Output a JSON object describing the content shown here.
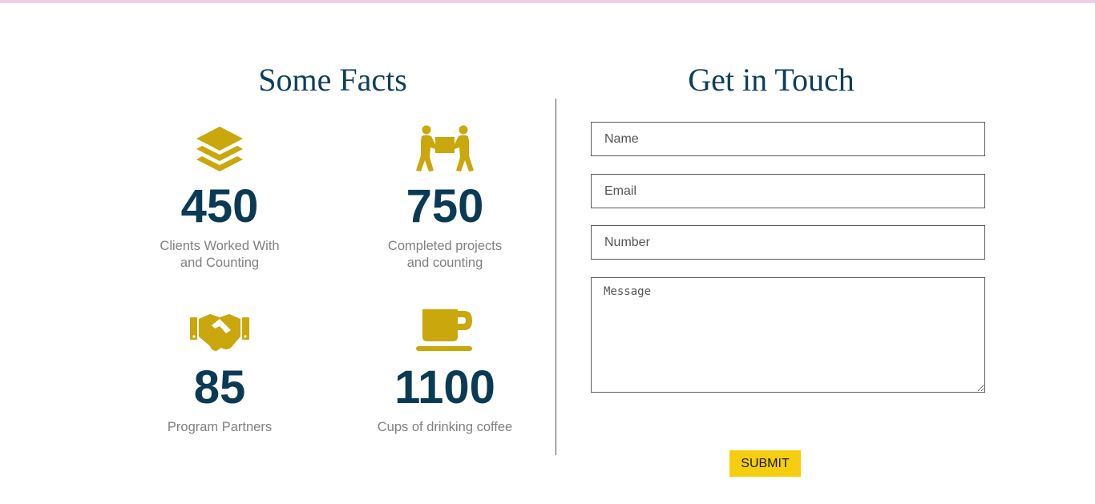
{
  "facts_section": {
    "title": "Some Facts",
    "items": [
      {
        "icon": "layers-icon",
        "number": "450",
        "label": "Clients Worked With and Counting"
      },
      {
        "icon": "people-carry-icon",
        "number": "750",
        "label": "Completed projects and counting"
      },
      {
        "icon": "handshake-icon",
        "number": "85",
        "label": "Program Partners"
      },
      {
        "icon": "coffee-cup-icon",
        "number": "1100",
        "label": "Cups of drinking coffee"
      }
    ]
  },
  "contact_section": {
    "title": "Get in Touch",
    "name_placeholder": "Name",
    "email_placeholder": "Email",
    "number_placeholder": "Number",
    "message_placeholder": "Message",
    "submit_label": "SUBMIT"
  },
  "colors": {
    "accent": "#c9a70d",
    "heading": "#0e3e5c",
    "number": "#0b3a55",
    "submit_bg": "#f5cf0f",
    "top_bar": "#ecd0e6"
  }
}
